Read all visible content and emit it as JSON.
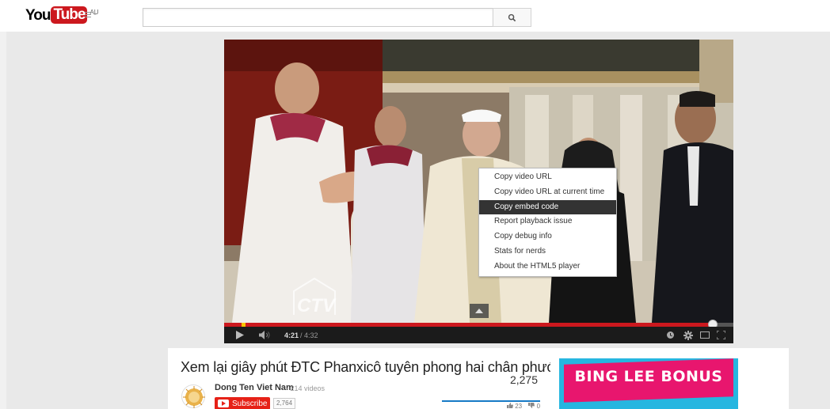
{
  "header": {
    "logo_you": "You",
    "logo_tube": "Tube",
    "logo_region": "AU",
    "search_placeholder": ""
  },
  "player": {
    "context_menu": [
      {
        "label": "Copy video URL",
        "active": false
      },
      {
        "label": "Copy video URL at current time",
        "active": false
      },
      {
        "label": "Copy embed code",
        "active": true
      },
      {
        "label": "Report playback issue",
        "active": false
      },
      {
        "label": "Copy debug info",
        "active": false
      },
      {
        "label": "Stats for nerds",
        "active": false
      },
      {
        "label": "About the HTML5 player",
        "active": false
      }
    ],
    "time_current": "4:21",
    "time_total": "/ 4:32",
    "progress_fraction": 0.96,
    "watermark": "CTV"
  },
  "video_info": {
    "title": "Xem lại giây phút ĐTC Phanxicô tuyên phong hai chân phước G…",
    "channel_name": "Dong Ten Viet Nam",
    "channel_videos": "· 214 videos",
    "subscribe_label": "Subscribe",
    "subscriber_count": "2,764",
    "view_count": "2,275",
    "like_count": "23",
    "dislike_count": "0"
  },
  "ad": {
    "text": "BING LEE BONUS"
  },
  "colors": {
    "brand_red": "#cc181e",
    "subscribe_red": "#e62117",
    "ad_pink": "#e8166e",
    "ad_cyan": "#26b6e0"
  }
}
